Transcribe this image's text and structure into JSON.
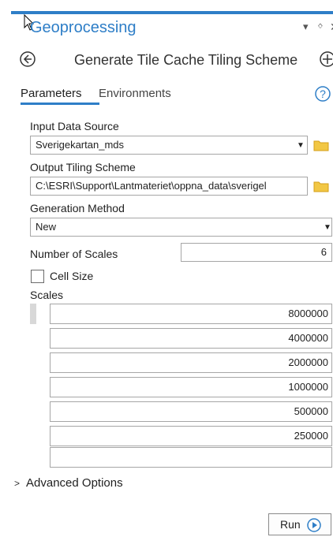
{
  "pane": {
    "title": "Geoprocessing",
    "pin_glyph": "▾",
    "dock_glyph": "ᛜ",
    "close_glyph": "✕"
  },
  "tool": {
    "title": "Generate Tile Cache Tiling Scheme"
  },
  "tabs": [
    {
      "label": "Parameters",
      "active": true
    },
    {
      "label": "Environments",
      "active": false
    }
  ],
  "params": {
    "input_data_source": {
      "label": "Input Data Source",
      "value": "Sverigekartan_mds"
    },
    "output_tiling_scheme": {
      "label": "Output Tiling Scheme",
      "value": "C:\\ESRI\\Support\\Lantmateriet\\oppna_data\\sverigel"
    },
    "generation_method": {
      "label": "Generation Method",
      "value": "New"
    },
    "number_of_scales": {
      "label": "Number of Scales",
      "value": "6"
    },
    "cell_size": {
      "label": "Cell Size",
      "checked": false
    },
    "scales": {
      "label": "Scales",
      "rows": [
        "8000000",
        "4000000",
        "2000000",
        "1000000",
        "500000",
        "250000",
        ""
      ]
    }
  },
  "advanced": {
    "label": "Advanced Options"
  },
  "run": {
    "label": "Run"
  },
  "colors": {
    "accent": "#2e7ec7",
    "folder": "#f2c744"
  }
}
